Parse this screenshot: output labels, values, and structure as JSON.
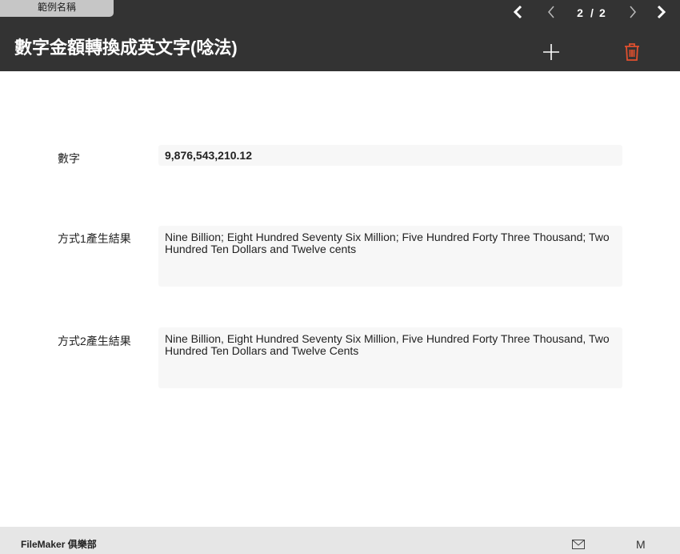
{
  "header": {
    "layout_name": "範例名稱",
    "title": "數字金額轉換成英文字(唸法)",
    "current_page": "2",
    "separator": "/",
    "total_pages": "2",
    "icons": {
      "first": "chevron-left-bold-icon",
      "prev": "chevron-left-icon",
      "next": "chevron-right-icon",
      "last": "chevron-right-bold-icon",
      "add": "plus-icon",
      "delete": "trash-icon"
    },
    "delete_color": "#e2502e"
  },
  "form": {
    "number_label": "數字",
    "number_value": "9,876,543,210.12",
    "result1_label": "方式1產生結果",
    "result1_value": "Nine Billion; Eight Hundred Seventy Six Million; Five Hundred Forty Three Thousand; Two Hundred Ten Dollars and Twelve cents",
    "result2_label": "方式2產生結果",
    "result2_value": "Nine Billion, Eight Hundred Seventy Six Million, Five Hundred Forty Three Thousand, Two Hundred Ten Dollars and Twelve Cents"
  },
  "footer": {
    "brand": "FileMaker 俱樂部",
    "mail_icon": "mail-icon",
    "m_label": "M"
  }
}
